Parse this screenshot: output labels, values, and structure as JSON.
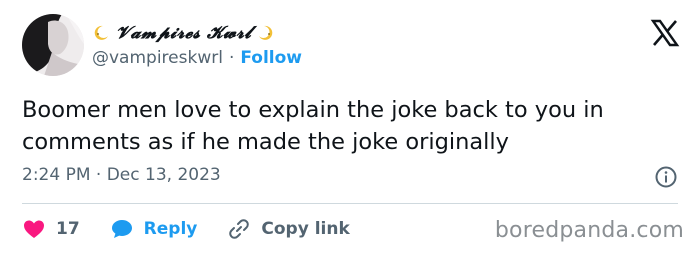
{
  "user": {
    "display_name": "𝓥𝓪𝓶𝓹𝓲𝓻𝓮𝓼 𝓚𝔀𝓻𝓵",
    "handle": "@vampireskwrl",
    "separator": "·",
    "follow_label": "Follow",
    "name_icons": [
      "crescent-moon-icon",
      "crescent-moon-icon"
    ]
  },
  "tweet": {
    "text": "Boomer men love to explain the joke back to you in comments as if he made the joke originally",
    "time": "2:24 PM",
    "separator": "·",
    "date": "Dec 13, 2023"
  },
  "actions": {
    "like_count": "17",
    "reply_label": "Reply",
    "copy_link_label": "Copy link"
  },
  "watermark": "boredpanda.com",
  "colors": {
    "accent": "#1d9bf0",
    "like": "#f91880",
    "text": "#0f1419",
    "muted": "#536471"
  }
}
